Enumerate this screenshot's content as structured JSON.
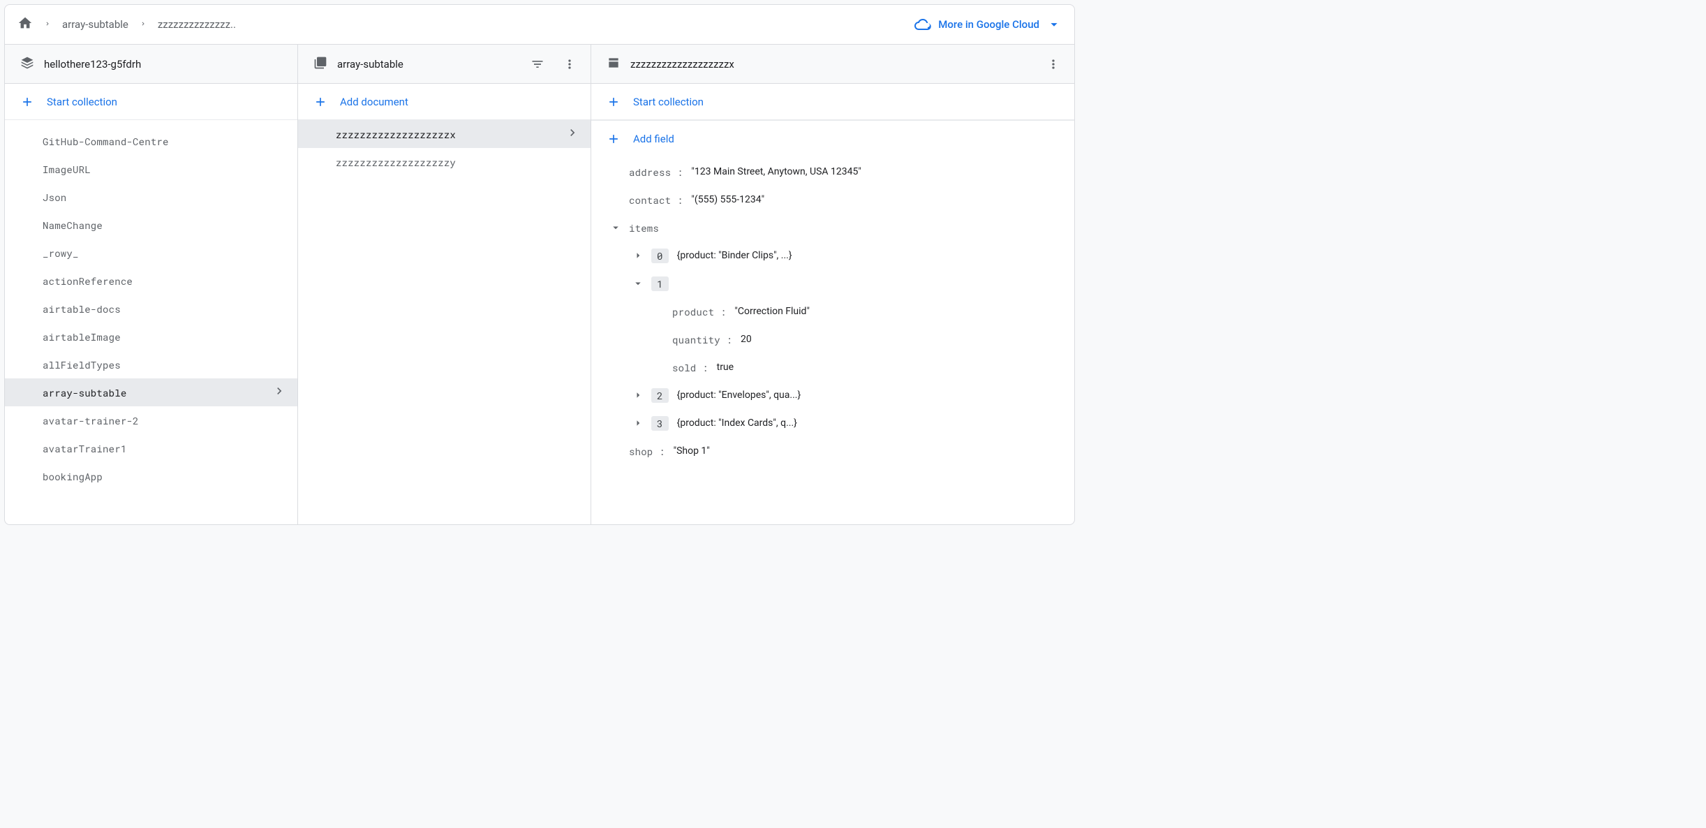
{
  "breadcrumb": {
    "item1": "array-subtable",
    "item2": "zzzzzzzzzzzzzz.."
  },
  "more_cloud_label": "More in Google Cloud",
  "col1": {
    "header": "hellothere123-g5fdrh",
    "start_collection_label": "Start collection",
    "items": [
      "GitHub-Command-Centre",
      "ImageURL",
      "Json",
      "NameChange",
      "_rowy_",
      "actionReference",
      "airtable-docs",
      "airtableImage",
      "allFieldTypes",
      "array-subtable",
      "avatar-trainer-2",
      "avatarTrainer1",
      "bookingApp"
    ],
    "selected_index": 9
  },
  "col2": {
    "header": "array-subtable",
    "add_document_label": "Add document",
    "items": [
      "zzzzzzzzzzzzzzzzzzzx",
      "zzzzzzzzzzzzzzzzzzzy"
    ],
    "selected_index": 0
  },
  "col3": {
    "header": "zzzzzzzzzzzzzzzzzzzx",
    "start_collection_label": "Start collection",
    "add_field_label": "Add field",
    "fields": {
      "address": {
        "key": "address",
        "value": "\"123 Main Street, Anytown, USA 12345\""
      },
      "contact": {
        "key": "contact",
        "value": "\"(555) 555-1234\""
      },
      "items_key": "items",
      "items": [
        {
          "idx": "0",
          "summary": "{product: \"Binder Clips\", ...}"
        },
        {
          "idx": "1",
          "expanded": true,
          "product": {
            "key": "product",
            "value": "\"Correction Fluid\""
          },
          "quantity": {
            "key": "quantity",
            "value": "20"
          },
          "sold": {
            "key": "sold",
            "value": "true"
          }
        },
        {
          "idx": "2",
          "summary": "{product: \"Envelopes\", qua...}"
        },
        {
          "idx": "3",
          "summary": "{product: \"Index Cards\", q...}"
        }
      ],
      "shop": {
        "key": "shop",
        "value": "\"Shop 1\""
      }
    }
  }
}
